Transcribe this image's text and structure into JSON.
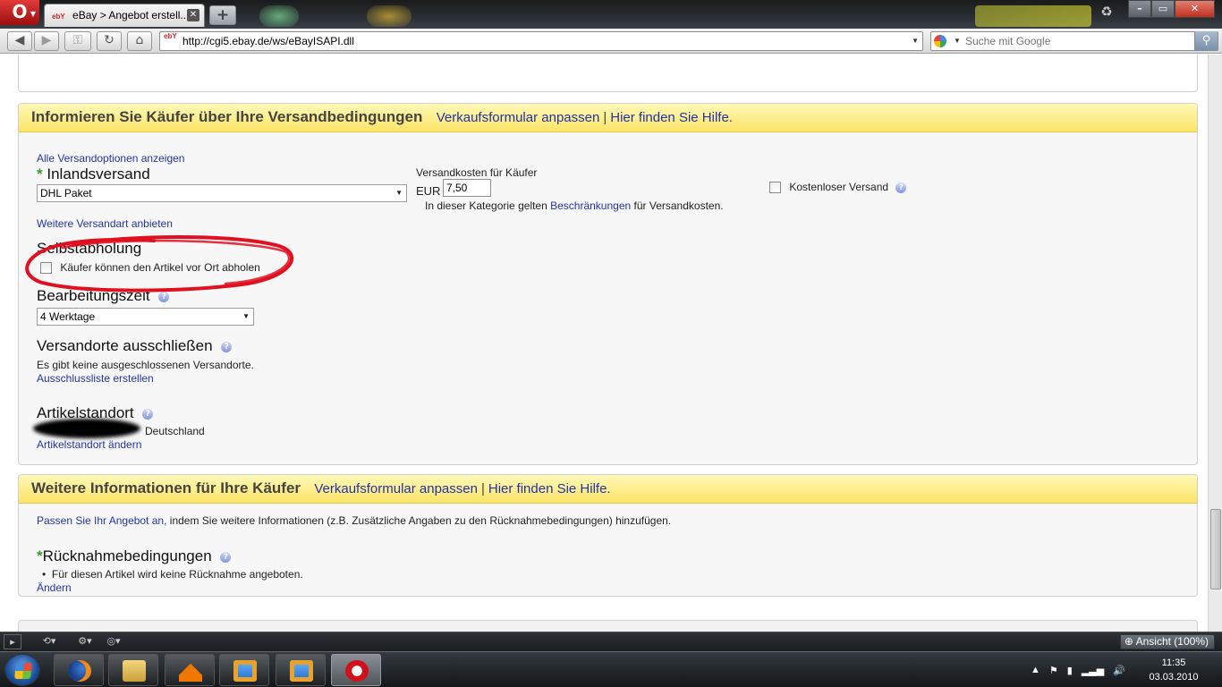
{
  "browser": {
    "tab_title": "eBay > Angebot erstell...",
    "tab_logo": "ebY",
    "url": "http://cgi5.ebay.de/ws/eBayISAPI.dll",
    "search_placeholder": "Suche mit Google",
    "zoom_label": "Ansicht (100%)"
  },
  "shipping": {
    "title": "Informieren Sie Käufer über Ihre Versandbedingungen",
    "link_customize": "Verkaufsformular anpassen",
    "separator": "|",
    "link_help": "Hier finden Sie Hilfe.",
    "all_options_link": "Alle Versandoptionen anzeigen",
    "required_mark": "*",
    "domestic_label": "Inlandsversand",
    "domestic_value": "DHL Paket",
    "cost_label": "Versandkosten für Käufer",
    "currency": "EUR",
    "cost_value": "7,50",
    "restriction_prefix": "In dieser Kategorie gelten",
    "restriction_link": "Beschränkungen",
    "restriction_suffix": "für Versandkosten.",
    "free_shipping_label": "Kostenloser Versand",
    "more_service_link": "Weitere Versandart anbieten",
    "pickup_label": "Selbstabholung",
    "pickup_checkbox_label": "Käufer können den Artikel vor Ort abholen",
    "handling_label": "Bearbeitungszeit",
    "handling_value": "4 Werktage",
    "exclude_label": "Versandorte ausschließen",
    "exclude_text": "Es gibt keine ausgeschlossenen Versandorte.",
    "exclude_link": "Ausschlussliste erstellen",
    "location_label": "Artikelstandort",
    "location_country": "Deutschland",
    "location_link": "Artikelstandort ändern"
  },
  "more_info": {
    "title": "Weitere Informationen für Ihre Käufer",
    "link_customize": "Verkaufsformular anpassen",
    "separator": "|",
    "link_help": "Hier finden Sie Hilfe.",
    "intro_link": "Passen Sie Ihr Angebot an,",
    "intro_text": "indem Sie weitere Informationen (z.B. Zusätzliche Angaben zu den Rücknahmebedingungen) hinzufügen.",
    "required_mark": "*",
    "returns_label": "Rücknahmebedingungen",
    "returns_bullet": "Für diesen Artikel wird keine Rücknahme angeboten.",
    "change_link": "Ändern"
  },
  "taskbar": {
    "time": "11:35",
    "date": "03.03.2010"
  },
  "colors": {
    "header_yellow": "#fbe467",
    "link_blue": "#2233aa",
    "required_green": "#3a9b2d",
    "annotation_red": "#e01020"
  }
}
